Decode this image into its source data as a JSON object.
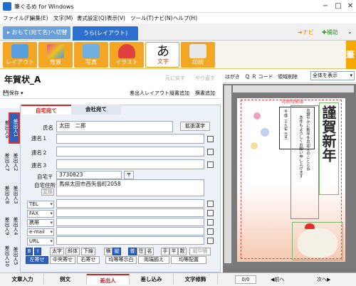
{
  "window": {
    "title": "筆ぐるめ for Windows"
  },
  "menu": [
    "ファイル(F)",
    "編集(E)",
    "文字(M)",
    "書式設定(Q)",
    "表示(V)",
    "ツール(T)",
    "ナビ(N)",
    "ヘルプ(H)"
  ],
  "mode_tabs": {
    "front": "おもて(宛て名)へ切替",
    "back": "うら(レイアウト)"
  },
  "top_right": {
    "navi": "ナビ",
    "help": "補助"
  },
  "toolbar": {
    "layout": "レイアウト",
    "background": "背景",
    "photo": "写真",
    "illust": "イラスト",
    "text": "文字",
    "print": "印刷"
  },
  "brand": {
    "char": "筆"
  },
  "document": {
    "title": "年賀状_A",
    "undo": "元に戻す",
    "redo": "やり直す"
  },
  "actions": {
    "save": "保存",
    "sender_layout": "差出人レイアウト",
    "vertical_add": "縦書追加",
    "horizontal_add": "横書追加"
  },
  "person_tabs": {
    "home": "自宅宛て",
    "company": "会社宛て"
  },
  "form": {
    "name_label": "氏名",
    "name_value": "太田　二郎",
    "ext_kanji": "拡張漢字",
    "joint1": "連名１",
    "joint2": "連名２",
    "joint3": "連名３",
    "zip_label": "自宅〒",
    "zip_value": "3730823",
    "zip_mark": "〒",
    "address_label": "自宅住所",
    "address_value": "馬県太田市西矢島町2058",
    "convert": "変換"
  },
  "contacts": [
    {
      "label": "TEL",
      "value": ""
    },
    {
      "label": "FAX",
      "value": ""
    },
    {
      "label": "携帯",
      "value": ""
    },
    {
      "label": "e-mail",
      "value": ""
    },
    {
      "label": "URL",
      "value": ""
    }
  ],
  "vertical_tabs": [
    {
      "label": "差出人6",
      "selected": false
    },
    {
      "label": "差出人1",
      "selected": true
    },
    {
      "label": "差出人7",
      "selected": false
    },
    {
      "label": "差出人2",
      "selected": false
    },
    {
      "label": "差出人8",
      "selected": false
    },
    {
      "label": "差出人3",
      "selected": false
    },
    {
      "label": "差出人9",
      "selected": false
    },
    {
      "label": "差出人4",
      "selected": false
    },
    {
      "label": "差出人10",
      "selected": false
    },
    {
      "label": "差出人5",
      "selected": false
    }
  ],
  "format_row": [
    "太字",
    "斜体",
    "下線",
    "横",
    "縦",
    "普",
    "住",
    "名",
    "手",
    "半",
    "数",
    "縦中横"
  ],
  "align_row": [
    "左寄せ",
    "中央寄せ",
    "右寄せ",
    "均等",
    "両端揃え",
    "均等配置"
  ],
  "bottom_tabs": [
    "文章入力",
    "例文",
    "差出人",
    "差し込み",
    "文字修飾"
  ],
  "preview": {
    "toolbar": [
      "はがき",
      "Ｑ Ｒ コード",
      "領域削除"
    ],
    "view_select": "全体を表示",
    "page": "0/0",
    "prev": "前へ",
    "next": "次へ"
  },
  "card": {
    "greeting": "謹賀新年",
    "message_col1": "お健やかに新年をお迎えのこととお",
    "message_col2": "本年もよろしくお願い申し上げます",
    "date_col": "平成二十九年 元旦",
    "label_top": "印刷可能領"
  },
  "colors": {
    "accent": "#2f6fd0",
    "orange": "#f3a623",
    "selected_red": "#d02020"
  }
}
